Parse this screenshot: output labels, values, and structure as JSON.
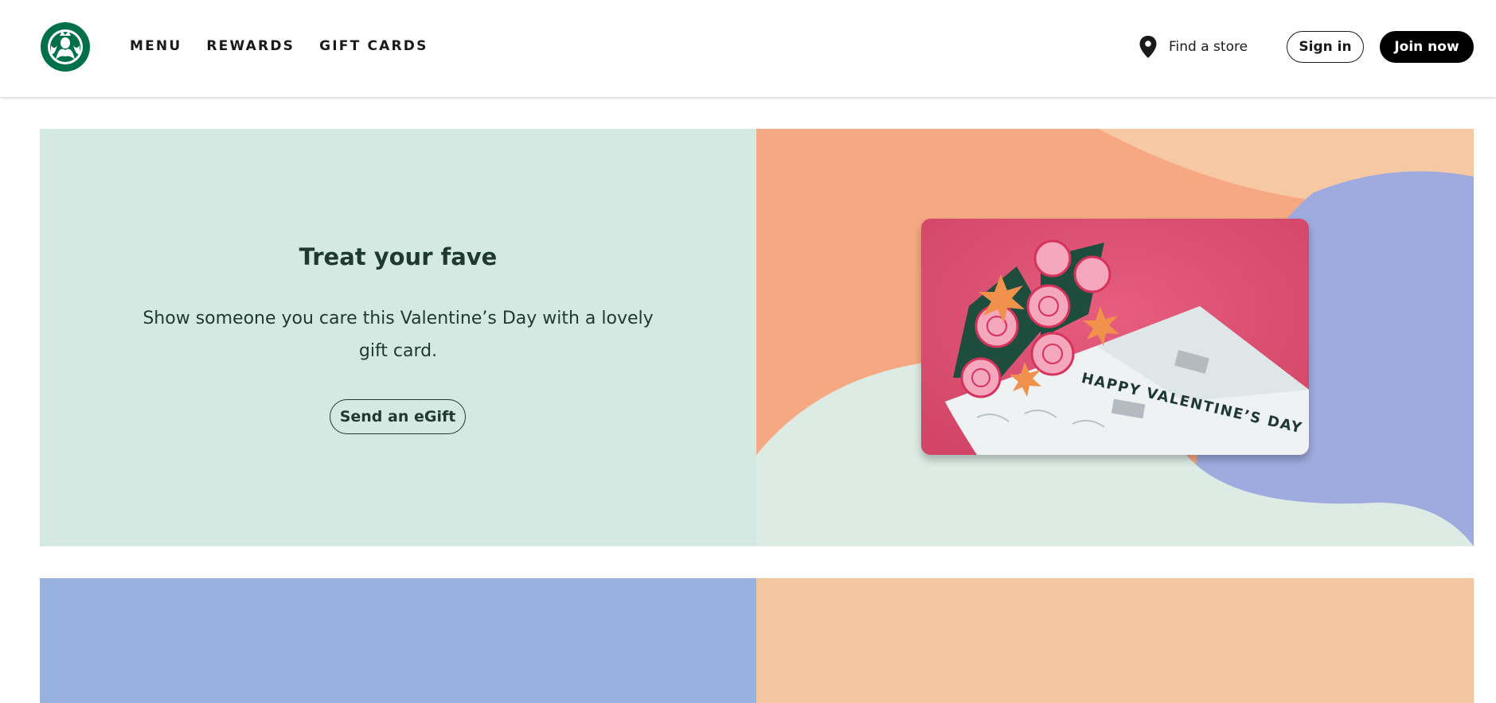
{
  "header": {
    "logo_icon": "starbucks-siren-logo",
    "nav": [
      {
        "label": "MENU"
      },
      {
        "label": "REWARDS"
      },
      {
        "label": "GIFT CARDS"
      }
    ],
    "find_store": {
      "label": "Find a store",
      "icon": "location-pin-icon"
    },
    "sign_in_label": "Sign in",
    "join_now_label": "Join now"
  },
  "hero": {
    "title": "Treat your fave",
    "text": "Show someone you care this Valentine’s Day with a lovely gift card.",
    "button_label": "Send an eGift",
    "card_text": "HAPPY VALENTINE’S DAY",
    "colors": {
      "panel": "#d4e9e2",
      "card": "#d9506f",
      "peach": "#f6a883",
      "blue": "#98a9dd",
      "mint": "#dcebe4"
    }
  },
  "tiles": {
    "colors": [
      "#98b2e0",
      "#f3c5a0"
    ]
  },
  "brand": {
    "green": "#00704a",
    "dark_green": "#1e3932"
  }
}
